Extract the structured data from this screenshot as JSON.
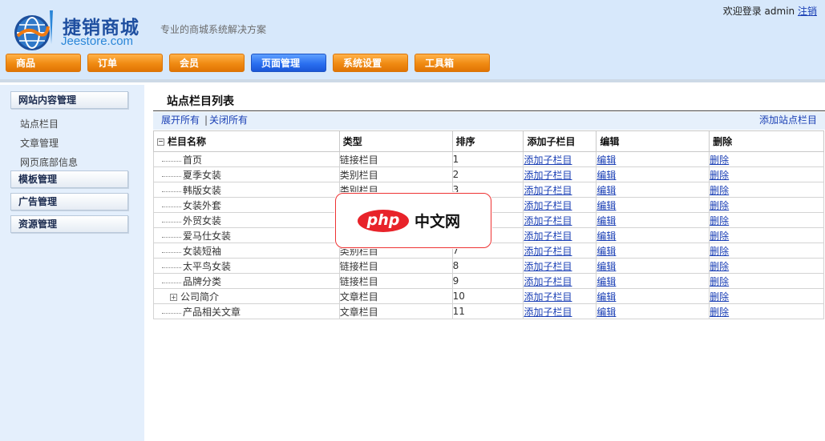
{
  "header": {
    "logo_name": "捷销商城",
    "logo_sub": "Jeestore.com",
    "slogan": "专业的商城系统解决方案",
    "welcome": "欢迎登录",
    "username": "admin",
    "logout": "注销"
  },
  "nav": [
    {
      "label": "商品",
      "active": false
    },
    {
      "label": "订单",
      "active": false
    },
    {
      "label": "会员",
      "active": false
    },
    {
      "label": "页面管理",
      "active": true
    },
    {
      "label": "系统设置",
      "active": false
    },
    {
      "label": "工具箱",
      "active": false
    }
  ],
  "sidebar": {
    "groups": [
      {
        "label": "网站内容管理",
        "items": [
          "站点栏目",
          "文章管理",
          "网页底部信息"
        ]
      },
      {
        "label": "模板管理"
      },
      {
        "label": "广告管理"
      },
      {
        "label": "资源管理"
      }
    ]
  },
  "main": {
    "title": "站点栏目列表",
    "expand_all": "展开所有",
    "separator": "|",
    "collapse_all": "关闭所有",
    "add_root": "添加站点栏目",
    "columns": [
      "栏目名称",
      "类型",
      "排序",
      "添加子栏目",
      "编辑",
      "删除"
    ],
    "rows": [
      {
        "name": "首页",
        "type": "链接栏目",
        "order": "1",
        "expandable": false
      },
      {
        "name": "夏季女装",
        "type": "类别栏目",
        "order": "2",
        "expandable": false
      },
      {
        "name": "韩版女装",
        "type": "类别栏目",
        "order": "3",
        "expandable": false
      },
      {
        "name": "女装外套",
        "type": "",
        "order": "",
        "expandable": false
      },
      {
        "name": "外贸女装",
        "type": "",
        "order": "",
        "expandable": false
      },
      {
        "name": "爱马仕女装",
        "type": "",
        "order": "",
        "expandable": false
      },
      {
        "name": "女装短袖",
        "type": "类别栏目",
        "order": "7",
        "expandable": false
      },
      {
        "name": "太平鸟女装",
        "type": "链接栏目",
        "order": "8",
        "expandable": false
      },
      {
        "name": "品牌分类",
        "type": "链接栏目",
        "order": "9",
        "expandable": false
      },
      {
        "name": "公司简介",
        "type": "文章栏目",
        "order": "10",
        "expandable": true
      },
      {
        "name": "产品相关文章",
        "type": "文章栏目",
        "order": "11",
        "expandable": false
      }
    ],
    "action_add_child": "添加子栏目",
    "action_edit": "编辑",
    "action_delete": "删除"
  },
  "watermark": {
    "php": "php",
    "text": "中文网"
  }
}
